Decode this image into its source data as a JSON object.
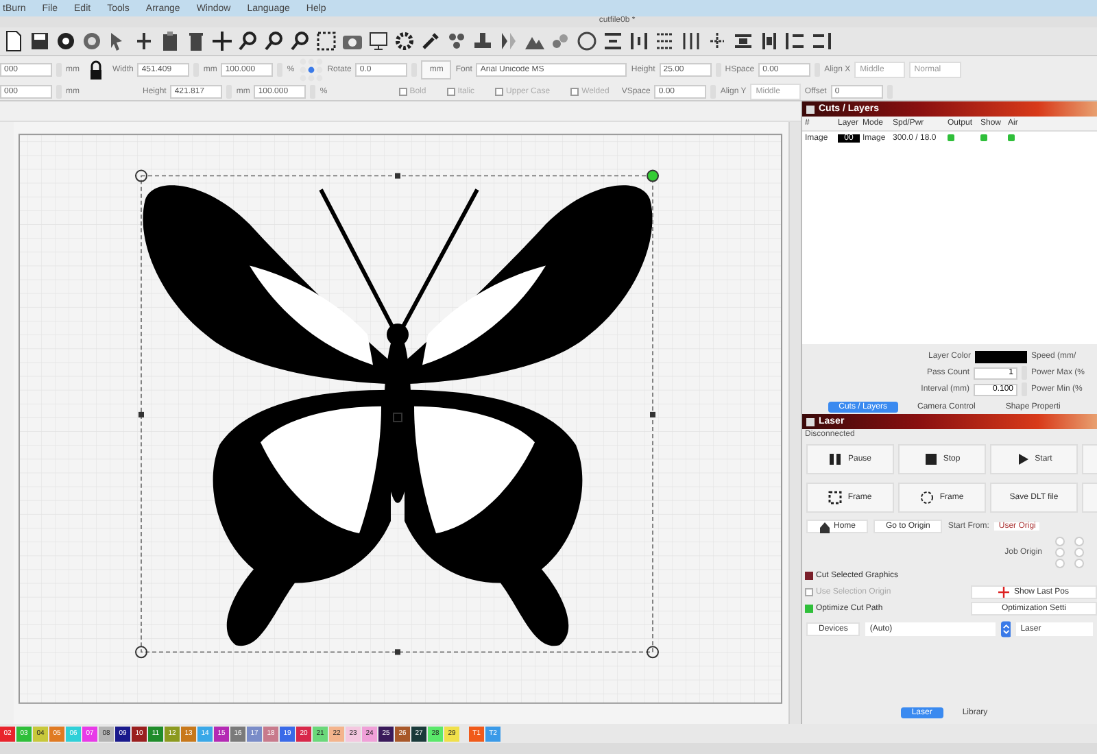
{
  "menu": [
    "tBurn",
    "File",
    "Edit",
    "Tools",
    "Arrange",
    "Window",
    "Language",
    "Help"
  ],
  "window": {
    "title": "cutfile0b *"
  },
  "props_rows": [
    [
      {
        "kind": "field",
        "value": "000"
      },
      {
        "kind": "label",
        "text": "mm"
      },
      {
        "kind": "lock"
      },
      {
        "kind": "label",
        "text": "Width"
      },
      {
        "kind": "field",
        "value": "451.409"
      },
      {
        "kind": "label",
        "text": "mm"
      },
      {
        "kind": "field",
        "value": "100.000"
      },
      {
        "kind": "label",
        "text": "%"
      },
      {
        "kind": "anchor"
      },
      {
        "kind": "label",
        "text": "Rotate"
      },
      {
        "kind": "field",
        "value": "0.0"
      },
      {
        "kind": "button",
        "text": "mm"
      },
      {
        "kind": "label",
        "text": "Font"
      },
      {
        "kind": "wide",
        "value": "Arial Unicode MS"
      },
      {
        "kind": "label",
        "text": "Height"
      },
      {
        "kind": "field",
        "value": "25.00"
      },
      {
        "kind": "label",
        "text": "HSpace"
      },
      {
        "kind": "field",
        "value": "0.00"
      },
      {
        "kind": "label",
        "text": "Align X"
      },
      {
        "kind": "select",
        "value": "Middle"
      },
      {
        "kind": "select",
        "value": "Normal"
      }
    ],
    [
      {
        "kind": "field",
        "value": "000"
      },
      {
        "kind": "label",
        "text": "mm"
      },
      {
        "kind": "gap"
      },
      {
        "kind": "label",
        "text": "Height"
      },
      {
        "kind": "field",
        "value": "421.817"
      },
      {
        "kind": "label",
        "text": "mm"
      },
      {
        "kind": "field",
        "value": "100.000"
      },
      {
        "kind": "label",
        "text": "%"
      },
      {
        "kind": "gap"
      },
      {
        "kind": "check",
        "text": "Bold",
        "checked": false,
        "disabled": true
      },
      {
        "kind": "check",
        "text": "Italic",
        "checked": false,
        "disabled": true
      },
      {
        "kind": "check",
        "text": "Upper Case",
        "checked": false,
        "disabled": true
      },
      {
        "kind": "check",
        "text": "Welded",
        "checked": false,
        "disabled": true
      },
      {
        "kind": "label",
        "text": "VSpace"
      },
      {
        "kind": "field",
        "value": "0.00"
      },
      {
        "kind": "label",
        "text": "Align Y"
      },
      {
        "kind": "select",
        "value": "Middle"
      },
      {
        "kind": "label",
        "text": "Offset"
      },
      {
        "kind": "field",
        "value": "0"
      }
    ]
  ],
  "cuts": {
    "title": "Cuts / Layers",
    "columns": [
      "#",
      "Layer",
      "Mode",
      "Spd/Pwr",
      "Output",
      "Show",
      "Air"
    ],
    "rows": [
      {
        "name": "Image",
        "layer": "00",
        "color": "#000000",
        "mode": "Image",
        "speed_power": "300.0 / 18.0",
        "output": true,
        "show": true,
        "air": true
      }
    ],
    "settings": [
      {
        "label": "Layer Color",
        "kind": "color",
        "color": "#000000",
        "right": "Speed (mm/"
      },
      {
        "label": "Pass Count",
        "kind": "value",
        "value": "1",
        "right": "Power Max (%"
      },
      {
        "label": "Interval (mm)",
        "kind": "value",
        "value": "0.100",
        "right": "Power Min (%"
      }
    ],
    "tabs": [
      {
        "label": "Cuts / Layers",
        "selected": true
      },
      {
        "label": "Camera Control",
        "selected": false
      },
      {
        "label": "Shape Properti",
        "selected": false
      }
    ]
  },
  "laser": {
    "title": "Laser",
    "status": "Disconnected",
    "buttons": [
      [
        {
          "kind": "pause",
          "label": "Pause"
        },
        {
          "kind": "stop",
          "label": "Stop"
        },
        {
          "kind": "play",
          "label": "Start"
        },
        {
          "kind": "blank"
        }
      ],
      [
        {
          "kind": "frame",
          "label": "Frame"
        },
        {
          "kind": "circle",
          "label": "Frame"
        },
        {
          "kind": "text",
          "label": "Save DLT file"
        },
        {
          "kind": "blank"
        }
      ]
    ],
    "home": "Home",
    "go_origin": "Go to Origin",
    "start_from_label": "Start From:",
    "start_from": "User Origi",
    "job_origin": "Job Origin",
    "checks": [
      {
        "label": "Cut Selected Graphics",
        "checked": true,
        "disabled": false,
        "color": "#7a1f2a"
      },
      {
        "label": "Use Selection Origin",
        "checked": false,
        "disabled": true,
        "color": "#aaaaaa"
      },
      {
        "label": "Optimize Cut Path",
        "checked": true,
        "disabled": false,
        "color": "#2fbf3a"
      }
    ],
    "side_buttons": [
      "Show Last Pos",
      "Optimization Setti"
    ],
    "devices": "Devices",
    "port": "(Auto)",
    "device": "Laser",
    "tabs": [
      {
        "label": "Laser",
        "selected": true
      },
      {
        "label": "Library",
        "selected": false
      }
    ]
  },
  "palette": [
    {
      "label": "02",
      "color": "#e8242c"
    },
    {
      "label": "03",
      "color": "#2fbf3a"
    },
    {
      "label": "04",
      "color": "#c8c83a"
    },
    {
      "label": "05",
      "color": "#e07a22"
    },
    {
      "label": "06",
      "color": "#2fd0d8"
    },
    {
      "label": "07",
      "color": "#e83ae8"
    },
    {
      "label": "08",
      "color": "#b4b4b4"
    },
    {
      "label": "09",
      "color": "#1a1a8c"
    },
    {
      "label": "10",
      "color": "#9a1f1f"
    },
    {
      "label": "11",
      "color": "#1f8c2a"
    },
    {
      "label": "12",
      "color": "#8c9a1f"
    },
    {
      "label": "13",
      "color": "#c8781a"
    },
    {
      "label": "14",
      "color": "#3aa8e8"
    },
    {
      "label": "15",
      "color": "#b42ab4"
    },
    {
      "label": "16",
      "color": "#7a7a7a"
    },
    {
      "label": "17",
      "color": "#7a8cc8"
    },
    {
      "label": "18",
      "color": "#c87a8c"
    },
    {
      "label": "19",
      "color": "#3a6ae8"
    },
    {
      "label": "20",
      "color": "#d8284a"
    },
    {
      "label": "21",
      "color": "#6ad87a"
    },
    {
      "label": "22",
      "color": "#f4b48c"
    },
    {
      "label": "23",
      "color": "#f4c8e0"
    },
    {
      "label": "24",
      "color": "#f0a0d8"
    },
    {
      "label": "25",
      "color": "#3a1a5a"
    },
    {
      "label": "26",
      "color": "#a8582a"
    },
    {
      "label": "27",
      "color": "#1a3a3a"
    },
    {
      "label": "28",
      "color": "#5ae86a"
    },
    {
      "label": "29",
      "color": "#f0e04a"
    },
    {
      "label": "T1",
      "color": "#f05a1a"
    },
    {
      "label": "T2",
      "color": "#3a9ae8"
    }
  ]
}
